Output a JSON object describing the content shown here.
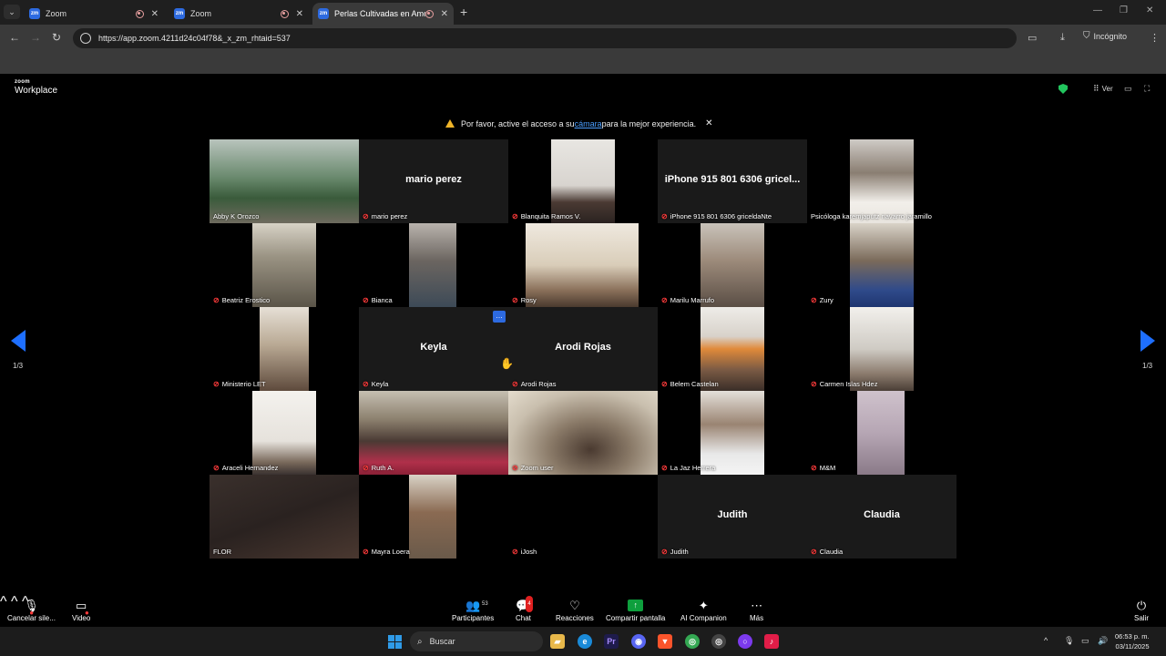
{
  "browser": {
    "tabs": [
      {
        "label": "Zoom",
        "active": false
      },
      {
        "label": "Zoom",
        "active": false
      },
      {
        "label": "Perlas Cultivadas en Amor",
        "active": true
      }
    ],
    "new_tab": "+",
    "url": "https://app.zoom.4211d24c04f78&_x_zm_rhtaid=537",
    "incognito_label": "Incógnito"
  },
  "zoom": {
    "brand_small": "zoom",
    "brand_big": "Workplace",
    "view_label": "Ver",
    "notice": {
      "before": "Por favor, active el acceso a su ",
      "link": "cámara",
      "after": " para la mejor experiencia."
    },
    "page_indicator": "1/3",
    "tile_menu": "…"
  },
  "participants": [
    {
      "name": "Abby K Orozco",
      "muted": false,
      "video": true,
      "speaking": true
    },
    {
      "name": "mario perez",
      "big_name": "mario perez",
      "muted": true,
      "video": false
    },
    {
      "name": "Blanquita Ramos V.",
      "muted": true,
      "video": true
    },
    {
      "name": "iPhone 915 801 6306 griceldaNte",
      "big_name": "iPhone 915 801 6306 gricel...",
      "muted": true,
      "video": false
    },
    {
      "name": "Psicóloga karemjaputz navarro jaramillo",
      "muted": false,
      "video": true
    },
    {
      "name": "Beatriz Erostico",
      "muted": true,
      "video": true
    },
    {
      "name": "Bianca",
      "muted": true,
      "video": true
    },
    {
      "name": "Rosy",
      "muted": true,
      "video": true
    },
    {
      "name": "Marilu Marrufo",
      "muted": true,
      "video": true
    },
    {
      "name": "Zury",
      "muted": true,
      "video": true
    },
    {
      "name": "Ministerio LET",
      "muted": true,
      "video": true
    },
    {
      "name": "Keyla",
      "big_name": "Keyla",
      "muted": true,
      "video": false
    },
    {
      "name": "Arodi Rojas",
      "big_name": "Arodi Rojas",
      "muted": true,
      "video": false
    },
    {
      "name": "Belem Castelan",
      "muted": true,
      "video": true
    },
    {
      "name": "Carmen Islas Hdez",
      "muted": true,
      "video": true
    },
    {
      "name": "Araceli Hernandez",
      "muted": true,
      "video": true
    },
    {
      "name": "Ruth A.",
      "muted": true,
      "video": true
    },
    {
      "name": "Zoom user",
      "muted": true,
      "video": true
    },
    {
      "name": "La Jaz Herrera",
      "muted": true,
      "video": true
    },
    {
      "name": "M&M",
      "muted": true,
      "video": true
    },
    {
      "name": "FLOR",
      "muted": false,
      "video": true
    },
    {
      "name": "Mayra Loera",
      "muted": true,
      "video": true
    },
    {
      "name": "iJosh",
      "muted": true,
      "video": false
    },
    {
      "name": "Judith",
      "big_name": "Judith",
      "muted": true,
      "video": false
    },
    {
      "name": "Claudia",
      "big_name": "Claudia",
      "muted": true,
      "video": false
    }
  ],
  "controls": {
    "mute_label": "Cancelar sile...",
    "video_label": "Video",
    "participants_label": "Participantes",
    "participants_count": "53",
    "chat_label": "Chat",
    "chat_badge": "4",
    "reactions_label": "Reacciones",
    "share_label": "Compartir pantalla",
    "ai_label": "AI Companion",
    "more_label": "Más",
    "leave_label": "Salir"
  },
  "taskbar": {
    "search_label": "Buscar",
    "time": "06:53 p. m.",
    "date": "03/11/2025"
  },
  "colors": {
    "accent_blue": "#1e6fff",
    "speaker_outline": "#c7d44a",
    "mute_red": "#ff3b3b",
    "share_green": "#0e9f3d"
  }
}
